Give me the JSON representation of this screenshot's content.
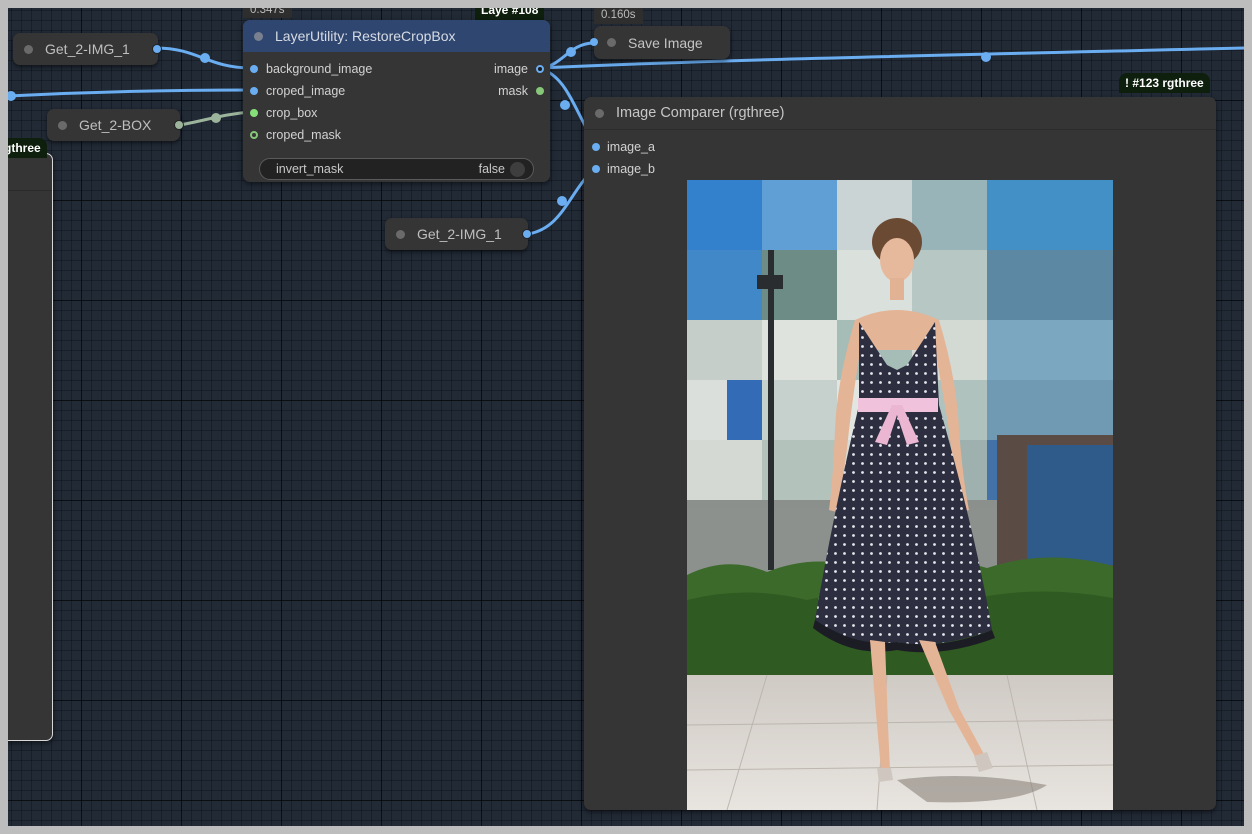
{
  "nodes": {
    "get_img_top": {
      "label": "Get_2-IMG_1"
    },
    "get_box": {
      "label": "Get_2-BOX"
    },
    "get_img_bottom": {
      "label": "Get_2-IMG_1"
    },
    "restore_crop": {
      "time": "0.347s",
      "badge_prefix": "Laye",
      "badge": "#108",
      "title": "LayerUtility: RestoreCropBox",
      "inputs": [
        "background_image",
        "croped_image",
        "crop_box",
        "croped_mask"
      ],
      "outputs": [
        "image",
        "mask"
      ],
      "widget": {
        "label": "invert_mask",
        "value": "false"
      }
    },
    "save_image": {
      "time": "0.160s",
      "title": "Save Image"
    },
    "image_comparer": {
      "badge": "#123 rgthree",
      "badge_prefix": "!",
      "title": "Image Comparer (rgthree)",
      "inputs": [
        "image_a",
        "image_b"
      ]
    },
    "left_partial": {
      "badge": "gthree"
    }
  },
  "colors": {
    "image_link": "#6aadf1",
    "box_link": "#9bb49b",
    "mask_port": "#86c77a",
    "header_active": "#2f4770"
  }
}
